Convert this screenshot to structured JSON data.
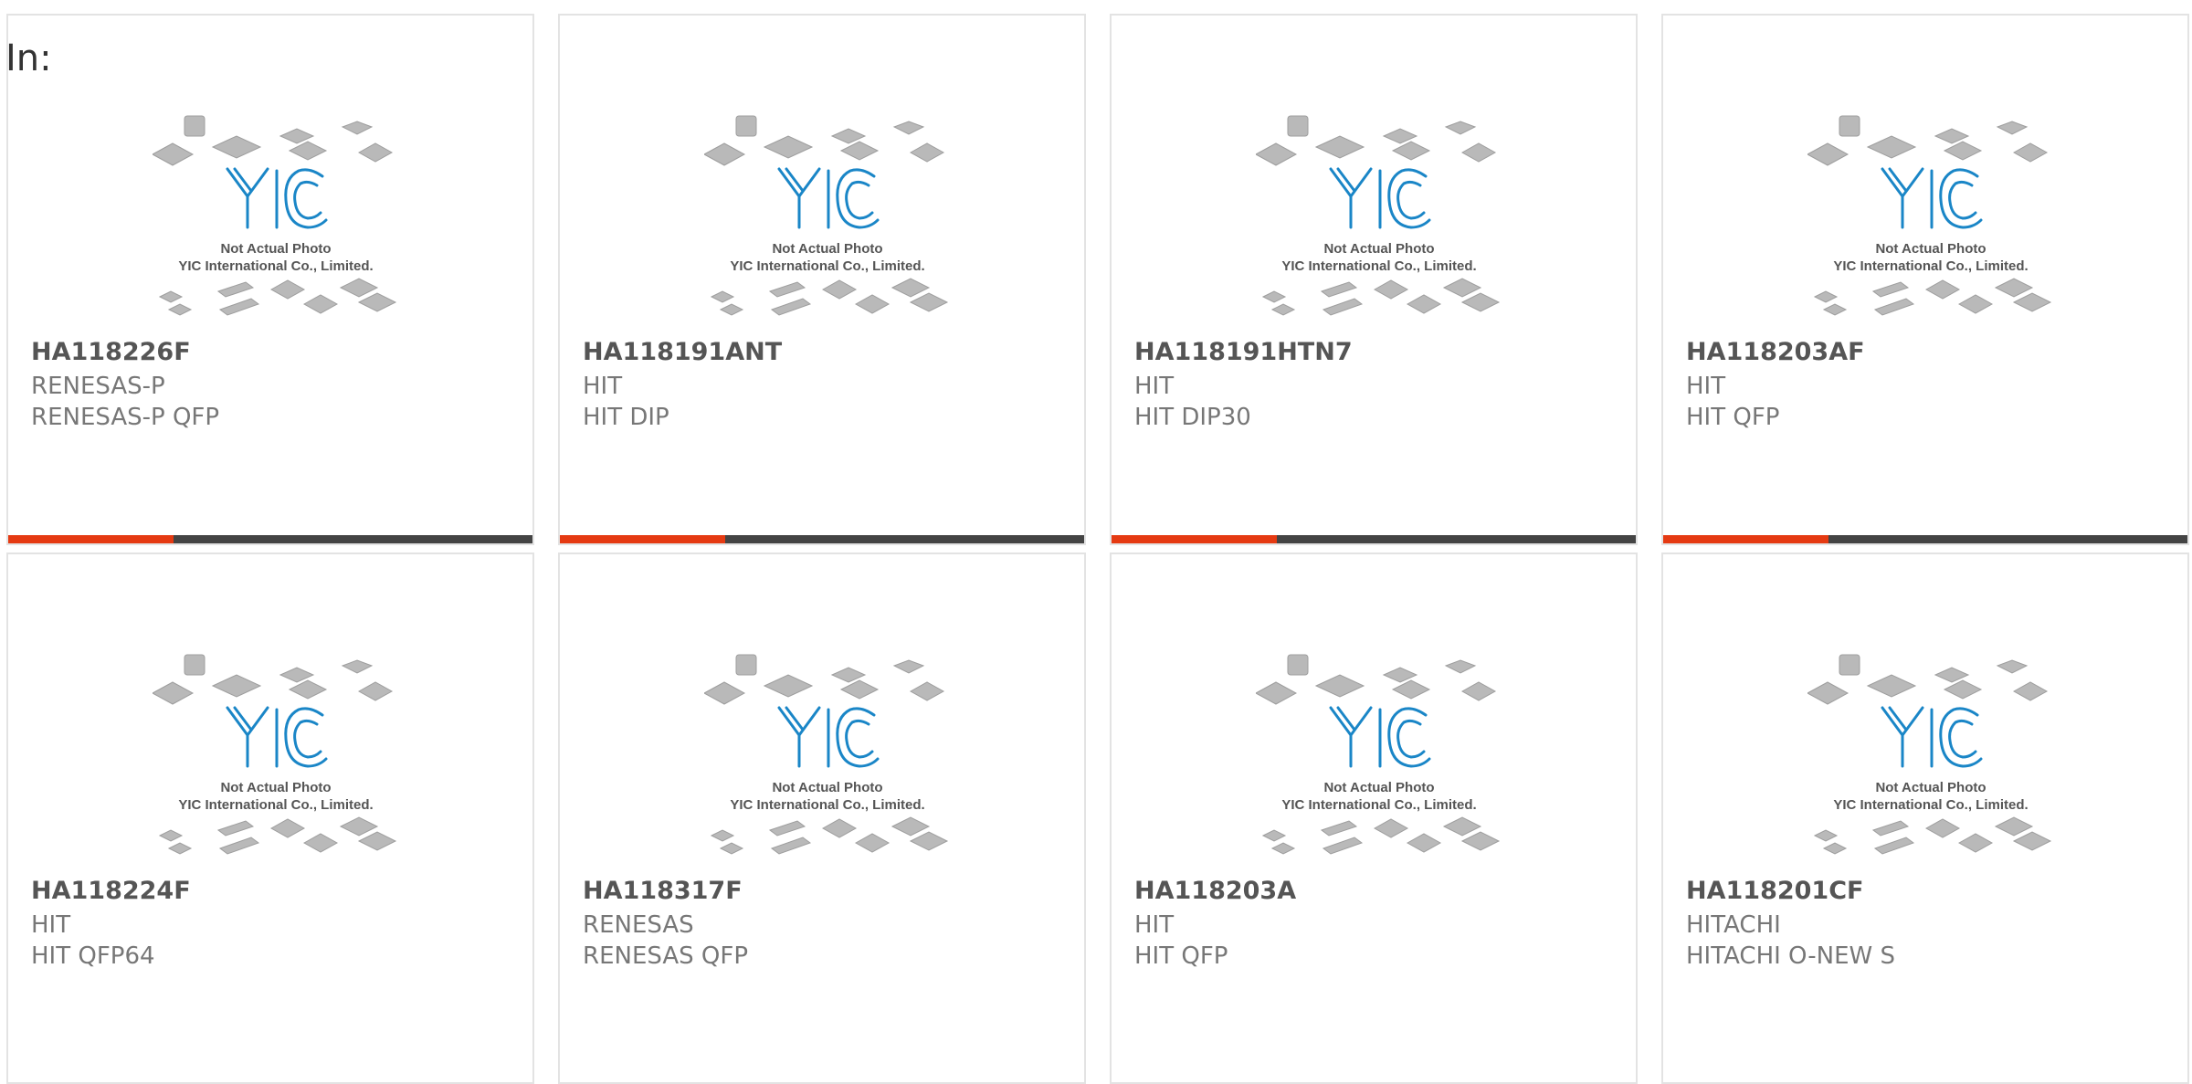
{
  "header": {
    "label": "In:"
  },
  "photo": {
    "line1": "Not Actual Photo",
    "line2": "YIC International Co., Limited."
  },
  "colors": {
    "accent": "#e53a12",
    "bar": "#444444",
    "logo": "#1a86c7"
  },
  "products": [
    {
      "part": "HA118226F",
      "manufacturer": "RENESAS-P",
      "package": "RENESAS-P QFP"
    },
    {
      "part": "HA118191ANT",
      "manufacturer": "HIT",
      "package": "HIT DIP"
    },
    {
      "part": "HA118191HTN7",
      "manufacturer": "HIT",
      "package": "HIT DIP30"
    },
    {
      "part": "HA118203AF",
      "manufacturer": "HIT",
      "package": "HIT QFP"
    },
    {
      "part": "HA118224F",
      "manufacturer": "HIT",
      "package": "HIT QFP64"
    },
    {
      "part": "HA118317F",
      "manufacturer": "RENESAS",
      "package": "RENESAS QFP"
    },
    {
      "part": "HA118203A",
      "manufacturer": "HIT",
      "package": "HIT QFP"
    },
    {
      "part": "HA118201CF",
      "manufacturer": "HITACHI",
      "package": "HITACHI O-NEW S"
    }
  ]
}
